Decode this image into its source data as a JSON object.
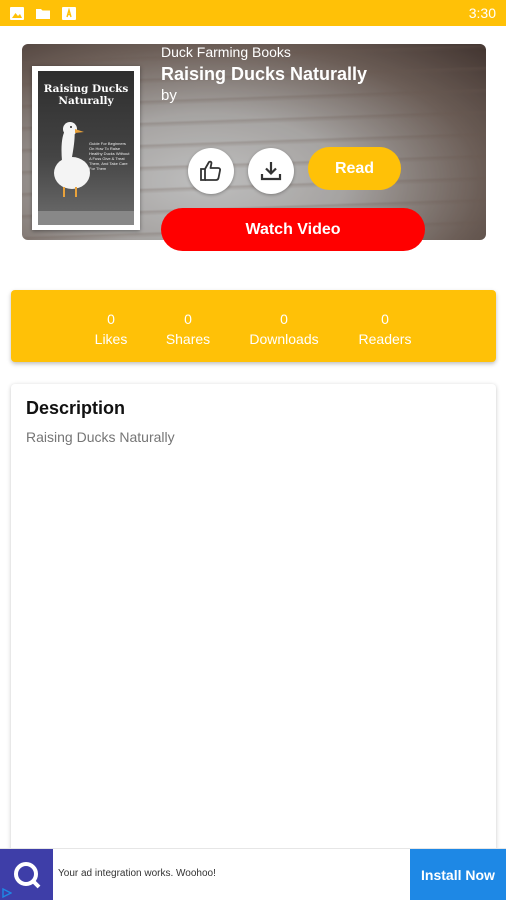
{
  "status_bar": {
    "time": "3:30",
    "icons": [
      "image-icon",
      "folder-icon",
      "app-icon"
    ]
  },
  "book": {
    "category": "Duck Farming Books",
    "title": "Raising Ducks Naturally",
    "author": "by",
    "cover": {
      "title": "Raising Ducks Naturally",
      "subtitle": "Guide For Beginners On How To Raise Healthy Ducks Without A Fuss Give & Treat Them, And Take Care For Them"
    }
  },
  "actions": {
    "like_icon": "thumbs-up-icon",
    "download_icon": "download-icon",
    "read_label": "Read",
    "watch_label": "Watch Video"
  },
  "stats": [
    {
      "value": "0",
      "label": "Likes"
    },
    {
      "value": "0",
      "label": "Shares"
    },
    {
      "value": "0",
      "label": "Downloads"
    },
    {
      "value": "0",
      "label": "Readers"
    }
  ],
  "description": {
    "heading": "Description",
    "text": "Raising Ducks Naturally"
  },
  "ad": {
    "text": "Your ad integration works. Woohoo!",
    "button": "Install Now"
  },
  "colors": {
    "accent": "#FFC107",
    "video": "#FF0000",
    "install": "#1E88E5"
  }
}
